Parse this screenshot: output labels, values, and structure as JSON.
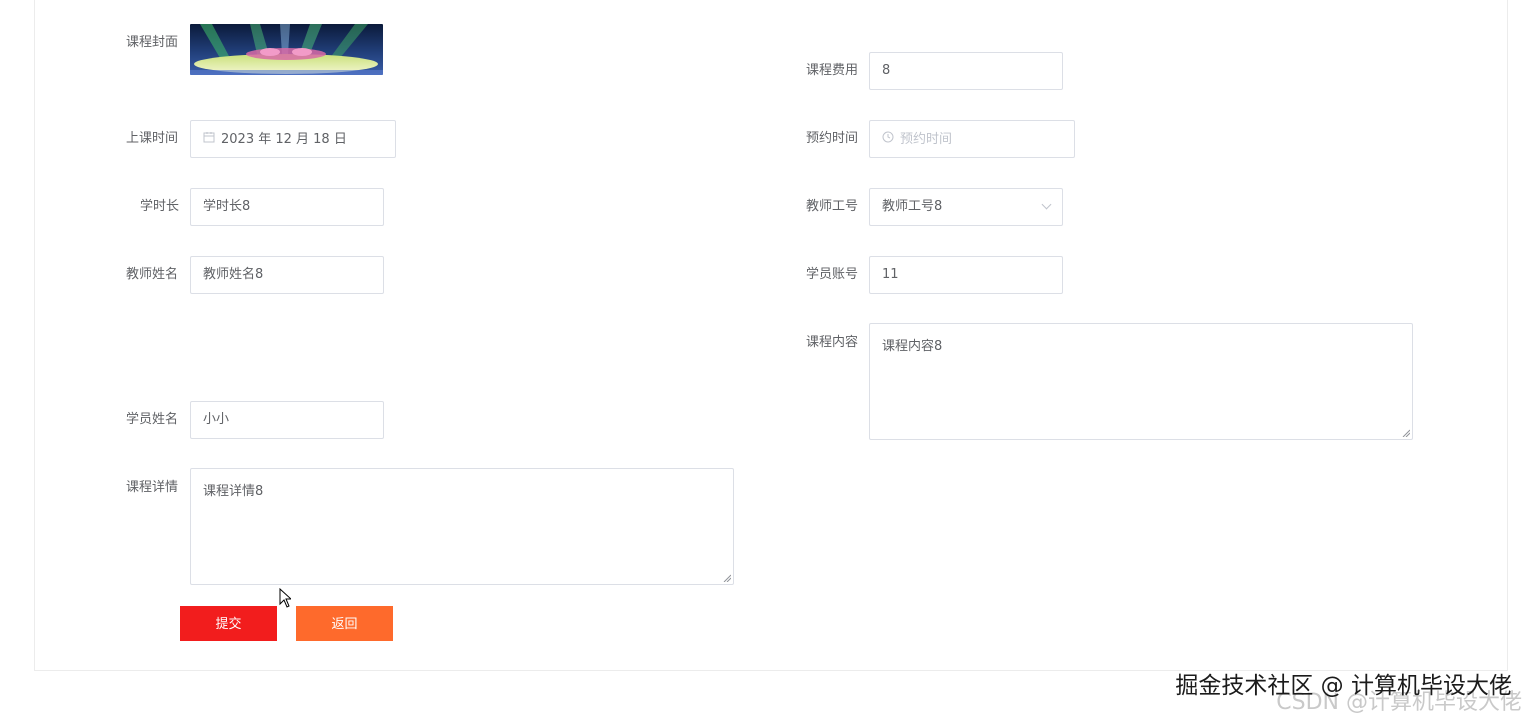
{
  "form": {
    "cover_label": "课程封面",
    "fee_label": "课程费用",
    "fee_value": "8",
    "class_time_label": "上课时间",
    "class_time_value": "2023 年 12 月 18 日",
    "booking_time_label": "预约时间",
    "booking_time_placeholder": "预约时间",
    "hours_label": "学时长",
    "hours_value": "学时长8",
    "teacher_id_label": "教师工号",
    "teacher_id_value": "教师工号8",
    "teacher_name_label": "教师姓名",
    "teacher_name_value": "教师姓名8",
    "student_account_label": "学员账号",
    "student_account_value": "11",
    "content_label": "课程内容",
    "content_value": "课程内容8",
    "student_name_label": "学员姓名",
    "student_name_value": "小小",
    "details_label": "课程详情",
    "details_value": "课程详情8"
  },
  "buttons": {
    "submit_label": "提交",
    "back_label": "返回"
  },
  "colors": {
    "submit": "#f21d1d",
    "back": "#fe6a2c",
    "border": "#dcdfe6",
    "placeholder": "#c0c4cc"
  },
  "icons": {
    "calendar": "calendar-icon",
    "clock": "clock-icon",
    "dropdown": "chevron-down-icon"
  },
  "watermark": {
    "main": "掘金技术社区 @ 计算机毕设大佬",
    "ghost": "CSDN @计算机毕设大佬"
  }
}
